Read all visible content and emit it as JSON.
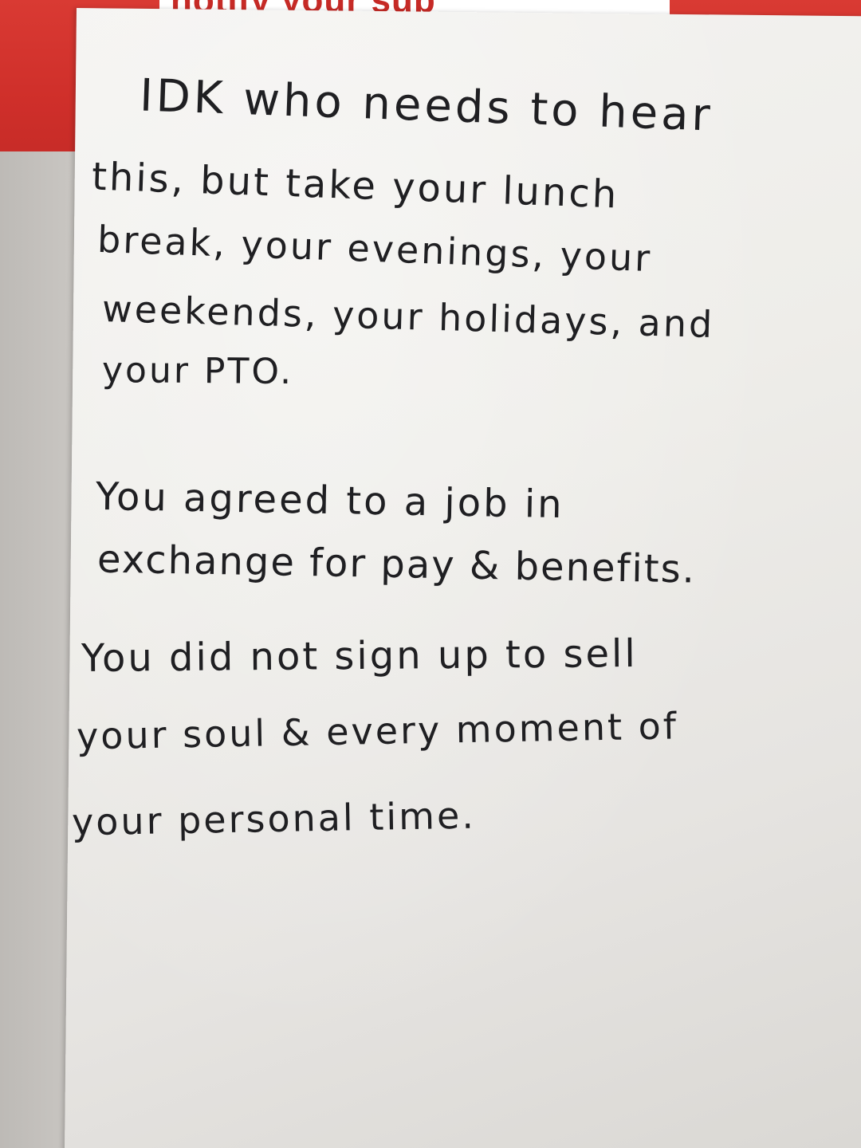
{
  "background_sign": {
    "text": "notify your sup"
  },
  "note": {
    "lines": [
      "IDK who needs to hear",
      "this, but take your lunch",
      "break, your evenings, your",
      "weekends, your holidays, and",
      "your PTO.",
      "You agreed to a job in",
      "exchange for pay & benefits.",
      "You did not sign up to sell",
      "your soul & every moment of",
      "your personal time."
    ]
  },
  "colors": {
    "red_surface": "#cf2f2a",
    "paper": "#eeede9",
    "ink": "#1f1f22"
  }
}
